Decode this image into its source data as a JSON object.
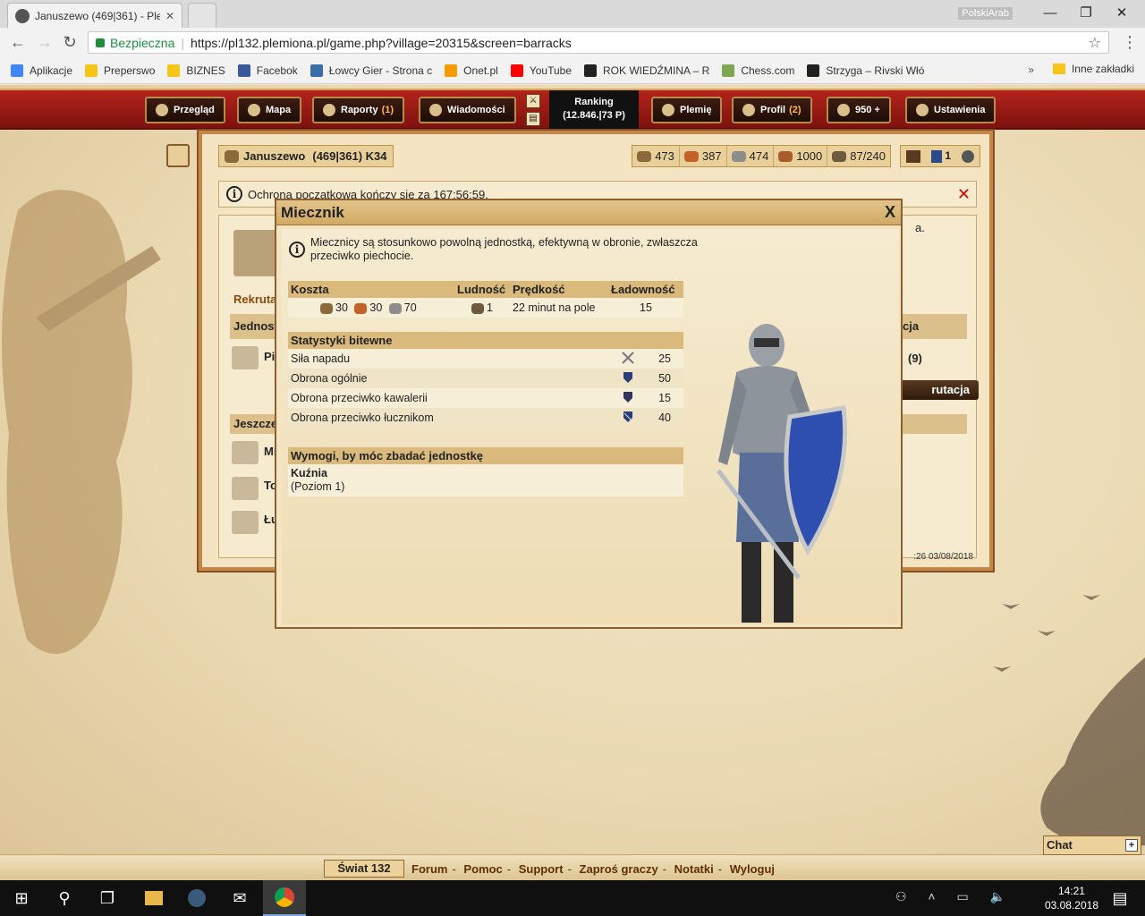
{
  "browser": {
    "tab_title": "Januszewo (469|361) - Ple",
    "window_user": "PolskiArab",
    "security_label": "Bezpieczna",
    "url": "https://pl132.plemiona.pl/game.php?village=20315&screen=barracks",
    "bookmarks": [
      {
        "label": "Aplikacje",
        "color": "#4285f4"
      },
      {
        "label": "Preperswo",
        "color": "#f5c518"
      },
      {
        "label": "BIZNES",
        "color": "#f5c518"
      },
      {
        "label": "Facebok",
        "color": "#3b5998"
      },
      {
        "label": "Łowcy Gier - Strona c",
        "color": "#3a6ea5"
      },
      {
        "label": "Onet.pl",
        "color": "#f59c00"
      },
      {
        "label": "YouTube",
        "color": "#ff0000"
      },
      {
        "label": "ROK WIEDŹMINA – R",
        "color": "#222222"
      },
      {
        "label": "Chess.com",
        "color": "#7fa650"
      },
      {
        "label": "Strzyga – Rivski Włó",
        "color": "#222222"
      }
    ],
    "bookmarks_more": "»",
    "other_bookmarks": "Inne zakładki"
  },
  "game_menu": {
    "items": [
      {
        "label": "Przegląd",
        "badge": ""
      },
      {
        "label": "Mapa",
        "badge": ""
      },
      {
        "label": "Raporty",
        "badge": "(1)"
      },
      {
        "label": "Wiadomości",
        "badge": ""
      },
      {
        "label": "Plemię",
        "badge": ""
      },
      {
        "label": "Profil",
        "badge": "(2)"
      },
      {
        "label": "950 +",
        "badge": ""
      },
      {
        "label": "Ustawienia",
        "badge": ""
      }
    ],
    "ranking_label": "Ranking",
    "ranking_value": "(12.846.|73 P)"
  },
  "village": {
    "name": "Januszewo",
    "coords": "(469|361) K34"
  },
  "resources": {
    "wood": "473",
    "clay": "387",
    "iron": "474",
    "storage": "1000",
    "population": "87/240"
  },
  "status_icons": {
    "support_count": "1"
  },
  "protection_notice": "Ochrona początkowa kończy się za 167:56:59.",
  "background": {
    "recruit_tab": "Rekruta",
    "units_header": "Jednost",
    "units_header_right": "cja",
    "unit_row_label": "Pik",
    "unit_row_count": "(9)",
    "recruit_button": "rutacja",
    "research_header": "Jeszcze",
    "research_rows": [
      "Mi",
      "To",
      "Łu"
    ],
    "fragment_text": "a.",
    "frame_timestamp": ":26 03/08/2018"
  },
  "popup": {
    "title": "Miecznik",
    "description": "Miecznicy są stosunkowo powolną jednostką, efektywną w obronie, zwłaszcza przeciwko piechocie.",
    "cost_table": {
      "headers": [
        "Koszta",
        "Ludność",
        "Prędkość",
        "Ładowność"
      ],
      "wood": "30",
      "clay": "30",
      "iron": "70",
      "population": "1",
      "speed": "22 minut na pole",
      "carry": "15"
    },
    "combat_stats": {
      "header": "Statystyki bitewne",
      "rows": [
        {
          "label": "Siła napadu",
          "value": "25",
          "icon": "attack-icon"
        },
        {
          "label": "Obrona ogólnie",
          "value": "50",
          "icon": "defense-icon"
        },
        {
          "label": "Obrona przeciwko kawalerii",
          "value": "15",
          "icon": "cavalry-defense-icon"
        },
        {
          "label": "Obrona przeciwko łucznikom",
          "value": "40",
          "icon": "archer-defense-icon"
        }
      ]
    },
    "requirements": {
      "header": "Wymogi, by móc zbadać jednostkę",
      "building": "Kuźnia",
      "level": "(Poziom 1)"
    }
  },
  "footer": {
    "world": "Świat 132",
    "links": [
      "Forum",
      "Pomoc",
      "Support",
      "Zaproś graczy",
      "Notatki",
      "Wyloguj"
    ],
    "chat": "Chat"
  },
  "taskbar": {
    "time": "14:21",
    "date": "03.08.2018"
  },
  "colors": {
    "menu_red": "#9b1b14",
    "parchment": "#f4e4c1",
    "header_tan": "#d9ba7c",
    "close_red": "#cc0000"
  }
}
